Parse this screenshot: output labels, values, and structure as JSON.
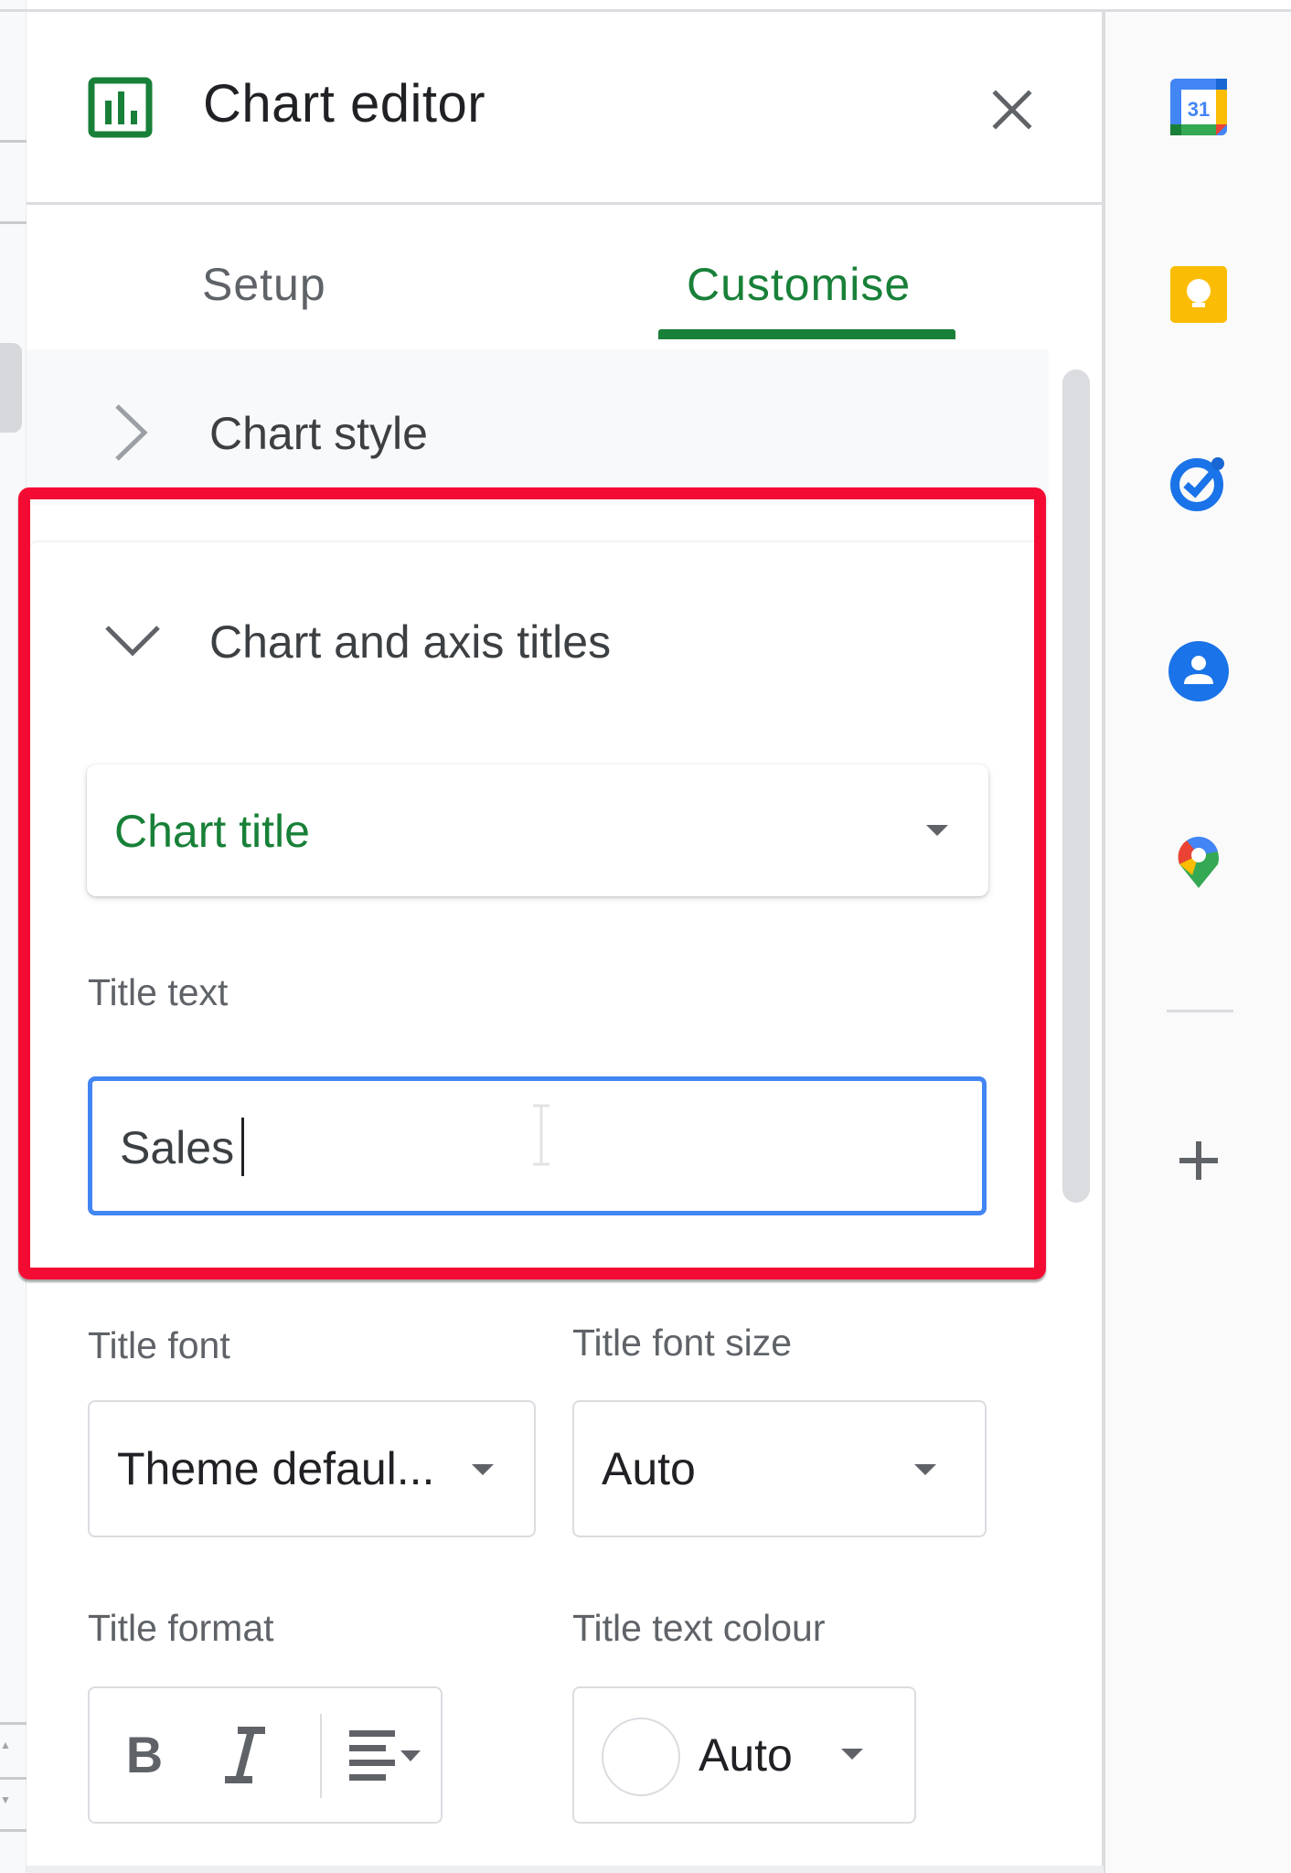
{
  "editor": {
    "title": "Chart editor",
    "close_icon": "close-icon",
    "chart_icon": "bar-chart-icon"
  },
  "tabs": [
    {
      "label": "Setup",
      "active": false
    },
    {
      "label": "Customise",
      "active": true
    }
  ],
  "sections": {
    "chart_style": {
      "label": "Chart style",
      "expanded": false
    },
    "chart_axis_titles": {
      "label": "Chart and axis titles",
      "expanded": true,
      "target_dropdown": {
        "value": "Chart title"
      },
      "title_text": {
        "label": "Title text",
        "value": "Sales"
      },
      "title_font": {
        "label": "Title font",
        "value": "Theme defaul..."
      },
      "title_font_size": {
        "label": "Title font size",
        "value": "Auto"
      },
      "title_format": {
        "label": "Title format",
        "bold_label": "B",
        "italic_label": "I",
        "align_icon": "align-left-icon"
      },
      "title_text_colour": {
        "label": "Title text colour",
        "value": "Auto"
      }
    }
  },
  "side_panel": {
    "icons": [
      "calendar-icon",
      "keep-icon",
      "tasks-icon",
      "contacts-icon",
      "maps-icon"
    ],
    "calendar_day": "31",
    "add_icon": "plus-icon"
  },
  "colors": {
    "accent_green": "#188038",
    "focus_blue": "#4285f4",
    "highlight_red": "#f40b33"
  }
}
